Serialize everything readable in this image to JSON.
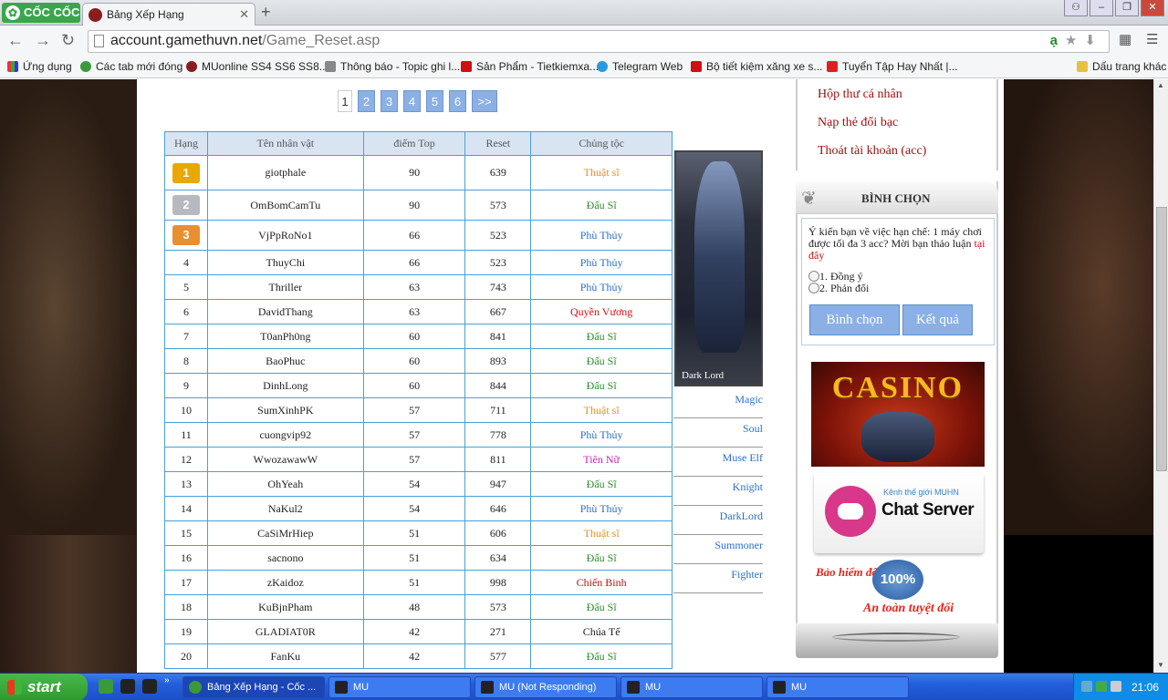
{
  "browser": {
    "logo": "CỐC CỐC",
    "tab_title": "Bảng Xếp Hạng",
    "url_host": "account.gamethuvn.net",
    "url_path": "/Game_Reset.asp",
    "bookmarks": [
      "Ứng dụng",
      "Các tab mới đóng",
      "MUonline SS4 SS6 SS8...",
      "Thông báo - Topic ghi l...",
      "Sản Phẩm - Tietkiemxa...",
      "Telegram Web",
      "Bộ tiết kiệm xăng xe s...",
      "Tuyển Tập Hay Nhất |..."
    ],
    "bookmarks_folder": "Dấu trang khác"
  },
  "pager": {
    "pages": [
      "1",
      "2",
      "3",
      "4",
      "5",
      "6"
    ],
    "next": ">>"
  },
  "ranking": {
    "headers": [
      "Hạng",
      "Tên nhân vật",
      "điểm Top",
      "Reset",
      "Chủng tộc"
    ],
    "rows": [
      {
        "rank": "1",
        "name": "giotphale",
        "top": "90",
        "reset": "639",
        "race": "Thuật sĩ",
        "color": "#e8901a"
      },
      {
        "rank": "2",
        "name": "OmBomCamTu",
        "top": "90",
        "reset": "573",
        "race": "Đấu Sĩ",
        "color": "#2a8a2a"
      },
      {
        "rank": "3",
        "name": "VjPpRoNo1",
        "top": "66",
        "reset": "523",
        "race": "Phù Thủy",
        "color": "#2a6fc9"
      },
      {
        "rank": "4",
        "name": "ThuyChi",
        "top": "66",
        "reset": "523",
        "race": "Phù Thủy",
        "color": "#2a6fc9"
      },
      {
        "rank": "5",
        "name": "Thriller",
        "top": "63",
        "reset": "743",
        "race": "Phù Thủy",
        "color": "#2a6fc9"
      },
      {
        "rank": "6",
        "name": "DavidThang",
        "top": "63",
        "reset": "667",
        "race": "Quyền Vương",
        "color": "#d01010"
      },
      {
        "rank": "7",
        "name": "T0anPh0ng",
        "top": "60",
        "reset": "841",
        "race": "Đấu Sĩ",
        "color": "#2a8a2a"
      },
      {
        "rank": "8",
        "name": "BaoPhuc",
        "top": "60",
        "reset": "893",
        "race": "Đấu Sĩ",
        "color": "#2a8a2a"
      },
      {
        "rank": "9",
        "name": "DinhLong",
        "top": "60",
        "reset": "844",
        "race": "Đấu Sĩ",
        "color": "#2a8a2a"
      },
      {
        "rank": "10",
        "name": "SumXinhPK",
        "top": "57",
        "reset": "711",
        "race": "Thuật sĩ",
        "color": "#e8901a"
      },
      {
        "rank": "11",
        "name": "cuongvip92",
        "top": "57",
        "reset": "778",
        "race": "Phù Thủy",
        "color": "#2a6fc9"
      },
      {
        "rank": "12",
        "name": "WwozawawW",
        "top": "57",
        "reset": "811",
        "race": "Tiên Nữ",
        "color": "#d020b0"
      },
      {
        "rank": "13",
        "name": "OhYeah",
        "top": "54",
        "reset": "947",
        "race": "Đấu Sĩ",
        "color": "#2a8a2a"
      },
      {
        "rank": "14",
        "name": "NaKul2",
        "top": "54",
        "reset": "646",
        "race": "Phù Thủy",
        "color": "#2a6fc9"
      },
      {
        "rank": "15",
        "name": "CaSiMrHiep",
        "top": "51",
        "reset": "606",
        "race": "Thuật sĩ",
        "color": "#e8901a"
      },
      {
        "rank": "16",
        "name": "sacnono",
        "top": "51",
        "reset": "634",
        "race": "Đấu Sĩ",
        "color": "#2a8a2a"
      },
      {
        "rank": "17",
        "name": "zKaidoz",
        "top": "51",
        "reset": "998",
        "race": "Chiến Binh",
        "color": "#c01010"
      },
      {
        "rank": "18",
        "name": "KuBjnPham",
        "top": "48",
        "reset": "573",
        "race": "Đấu Sĩ",
        "color": "#2a8a2a"
      },
      {
        "rank": "19",
        "name": "GLADIAT0R",
        "top": "42",
        "reset": "271",
        "race": "Chúa Tể",
        "color": "#222222"
      },
      {
        "rank": "20",
        "name": "FanKu",
        "top": "42",
        "reset": "577",
        "race": "Đấu Sĩ",
        "color": "#2a8a2a"
      }
    ]
  },
  "character": {
    "caption": "Dark Lord",
    "classes": [
      "Magic",
      "Soul",
      "Muse Elf",
      "Knight",
      "DarkLord",
      "Summoner",
      "Fighter"
    ]
  },
  "side_menu": [
    "Hộp thư cá nhân",
    "Nạp thẻ đổi bạc",
    "Thoát tài khoản (acc)"
  ],
  "vote": {
    "title": "BÌNH CHỌN",
    "question": "Ý kiến bạn về việc hạn chế: 1 máy chơi được tối đa 3 acc? Mời bạn thảo luận",
    "link": "tại đây",
    "options": [
      "1. Đồng ý",
      "2. Phản đối"
    ],
    "vote_btn": "Bình chọn",
    "result_btn": "Kết quả"
  },
  "ads": {
    "casino": "CASINO",
    "chat_kicker": "Kênh thế giới MUHN",
    "chat_title": "Chat Server",
    "insure_top": "Bảo hiểm độ",
    "insure_pct": "100%",
    "insure_bottom": "An toàn tuyệt đối"
  },
  "taskbar": {
    "start": "start",
    "tasks": [
      "Bảng Xếp Hạng - Cốc ...",
      "MU",
      "MU (Not Responding)",
      "MU",
      "MU"
    ],
    "time": "21:06"
  }
}
